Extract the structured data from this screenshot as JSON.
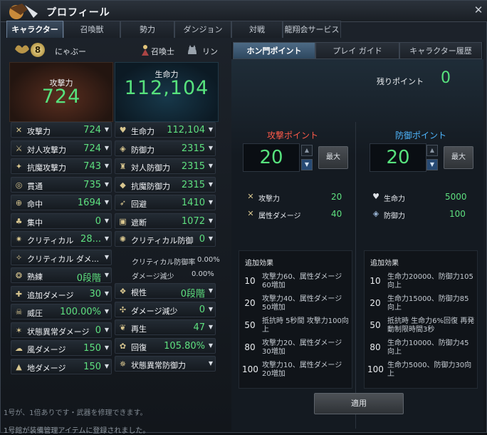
{
  "window": {
    "title": "プロフィール"
  },
  "tabs": [
    "キャラクター",
    "召喚獣",
    "勢力",
    "ダンジョン",
    "対戦",
    "龍翔会サービス"
  ],
  "character": {
    "level": "8",
    "name": "にゃぶー",
    "summon_label": "召喚士",
    "pet_name": "リン"
  },
  "big_stats": {
    "attack": {
      "label": "攻撃力",
      "value": "724"
    },
    "hp": {
      "label": "生命力",
      "value": "112,104"
    }
  },
  "left_stats": [
    {
      "label": "攻撃力",
      "value": "724",
      "icon": "swords-icon"
    },
    {
      "label": "対人攻撃力",
      "value": "724",
      "icon": "pvp-attack-icon"
    },
    {
      "label": "抗魔攻撃力",
      "value": "743",
      "icon": "anti-demon-attack-icon"
    },
    {
      "label": "貫通",
      "value": "735",
      "icon": "pierce-icon"
    },
    {
      "label": "命中",
      "value": "1694",
      "icon": "accuracy-icon"
    },
    {
      "label": "集中",
      "value": "0",
      "icon": "focus-icon"
    },
    {
      "label": "クリティカル",
      "value": "28...",
      "icon": "critical-icon"
    },
    {
      "label": "クリティカル ダメ...",
      "value": "",
      "icon": "critical-damage-icon"
    },
    {
      "label": "熟練",
      "value": "0段階",
      "icon": "mastery-icon"
    },
    {
      "label": "追加ダメージ",
      "value": "30",
      "icon": "additional-damage-icon"
    },
    {
      "label": "威圧",
      "value": "100.00%",
      "icon": "intimidation-icon"
    },
    {
      "label": "状態異常ダメージ",
      "value": "0",
      "icon": "status-damage-icon"
    },
    {
      "label": "風ダメージ",
      "value": "150",
      "icon": "wind-damage-icon"
    },
    {
      "label": "地ダメージ",
      "value": "150",
      "icon": "earth-damage-icon"
    }
  ],
  "mid_stats": [
    {
      "label": "生命力",
      "value": "112,104",
      "icon": "heart-icon"
    },
    {
      "label": "防御力",
      "value": "2315",
      "icon": "shield-icon"
    },
    {
      "label": "対人防御力",
      "value": "2315",
      "icon": "pvp-defense-icon"
    },
    {
      "label": "抗魔防御力",
      "value": "2315",
      "icon": "anti-demon-defense-icon"
    },
    {
      "label": "回避",
      "value": "1410",
      "icon": "evasion-icon"
    },
    {
      "label": "遮断",
      "value": "1072",
      "icon": "block-icon"
    },
    {
      "label": "クリティカル防御",
      "value": "0",
      "icon": "critical-defense-icon"
    }
  ],
  "crit_def_sub": [
    {
      "label": "クリティカル防御率",
      "value": "0.00%"
    },
    {
      "label": "ダメージ減少",
      "value": "0.00%"
    }
  ],
  "mid_stats2": [
    {
      "label": "根性",
      "value": "0段階",
      "icon": "willpower-icon"
    },
    {
      "label": "ダメージ減少",
      "value": "0",
      "icon": "damage-reduction-icon"
    },
    {
      "label": "再生",
      "value": "47",
      "icon": "regeneration-icon"
    },
    {
      "label": "回復",
      "value": "105.80%",
      "icon": "recovery-icon"
    },
    {
      "label": "状態異常防御力",
      "value": "",
      "icon": "status-defense-icon"
    }
  ],
  "right": {
    "tabs": [
      "ホン門ポイント",
      "プレイ ガイド",
      "キャラクター履歴"
    ],
    "remaining_label": "残りポイント",
    "remaining_value": "0",
    "attack_points": {
      "title": "攻撃ポイント",
      "value": "20",
      "max_label": "最大"
    },
    "defense_points": {
      "title": "防御ポイント",
      "value": "20",
      "max_label": "最大"
    },
    "attack_rows": [
      {
        "label": "攻撃力",
        "value": "20"
      },
      {
        "label": "属性ダメージ",
        "value": "40"
      }
    ],
    "defense_rows": [
      {
        "label": "生命力",
        "value": "5000"
      },
      {
        "label": "防御力",
        "value": "100"
      }
    ],
    "bonus_title": "追加効果",
    "attack_bonus": [
      {
        "n": "10",
        "text": "攻撃力60、属性ダメージ60増加"
      },
      {
        "n": "20",
        "text": "攻撃力40、属性ダメージ50増加"
      },
      {
        "n": "50",
        "text": "抵抗時 5秒間 攻撃力100向上"
      },
      {
        "n": "80",
        "text": "攻撃力20、属性ダメージ30増加"
      },
      {
        "n": "100",
        "text": "攻撃力10、属性ダメージ20増加"
      }
    ],
    "defense_bonus": [
      {
        "n": "10",
        "text": "生命力20000、防御力105向上"
      },
      {
        "n": "20",
        "text": "生命力15000、防御力85向上"
      },
      {
        "n": "50",
        "text": "抵抗時 生命力6%回復 再発動制限時間3秒"
      },
      {
        "n": "80",
        "text": "生命力10000、防御力45向上"
      },
      {
        "n": "100",
        "text": "生命力5000、防御力30向上"
      }
    ],
    "apply_label": "適用"
  },
  "footer": {
    "line1": "1号が、1倍ありです・武器を修理できます。",
    "line2": "1号館が装備管理アイテムに登録されました。"
  },
  "colors": {
    "value_green": "#57e27d",
    "attack_title": "#ff5a4a",
    "defense_title": "#4fb7ff"
  }
}
